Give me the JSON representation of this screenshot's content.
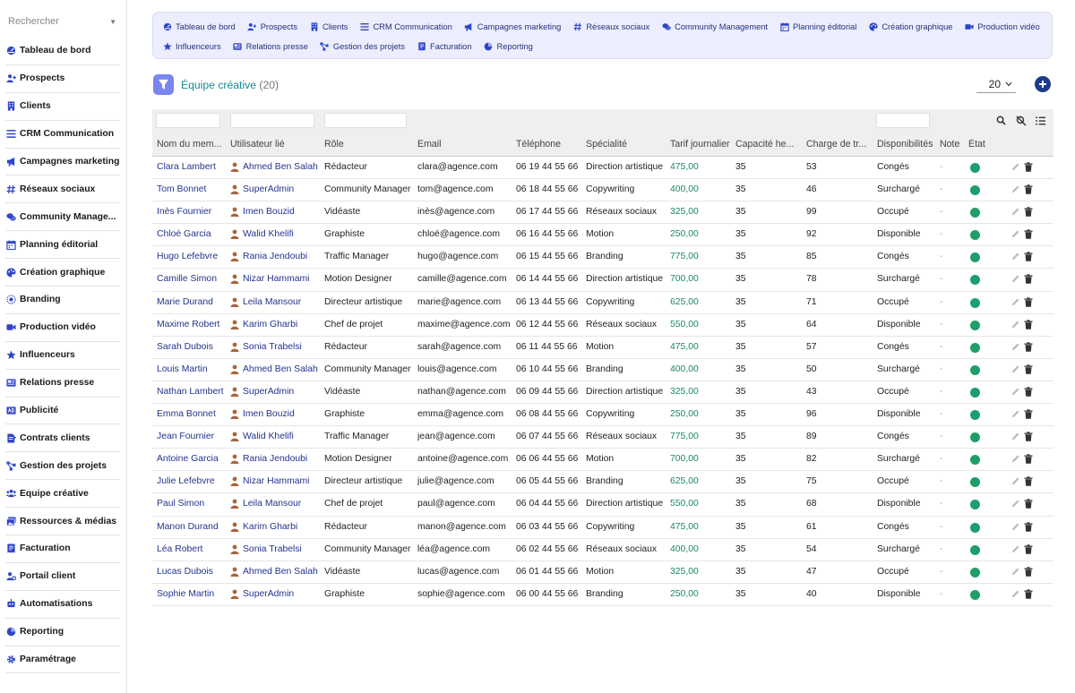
{
  "sidebar": {
    "search_placeholder": "Rechercher",
    "items": [
      {
        "label": "Tableau de bord",
        "icon": "dashboard-icon"
      },
      {
        "label": "Prospects",
        "icon": "user-plus-icon"
      },
      {
        "label": "Clients",
        "icon": "building-icon"
      },
      {
        "label": "CRM Communication",
        "icon": "list-icon"
      },
      {
        "label": "Campagnes marketing",
        "icon": "megaphone-icon"
      },
      {
        "label": "Réseaux sociaux",
        "icon": "hashtag-icon"
      },
      {
        "label": "Community Manage...",
        "icon": "chat-icon"
      },
      {
        "label": "Planning éditorial",
        "icon": "calendar-icon"
      },
      {
        "label": "Création graphique",
        "icon": "palette-icon"
      },
      {
        "label": "Branding",
        "icon": "brand-icon"
      },
      {
        "label": "Production vidéo",
        "icon": "video-icon"
      },
      {
        "label": "Influenceurs",
        "icon": "star-icon"
      },
      {
        "label": "Relations presse",
        "icon": "newspaper-icon"
      },
      {
        "label": "Publicité",
        "icon": "ad-icon"
      },
      {
        "label": "Contrats clients",
        "icon": "contract-icon"
      },
      {
        "label": "Gestion des projets",
        "icon": "project-icon"
      },
      {
        "label": "Équipe créative",
        "icon": "team-icon"
      },
      {
        "label": "Ressources & médias",
        "icon": "media-icon"
      },
      {
        "label": "Facturation",
        "icon": "invoice-icon"
      },
      {
        "label": "Portail client",
        "icon": "portal-icon"
      },
      {
        "label": "Automatisations",
        "icon": "robot-icon"
      },
      {
        "label": "Reporting",
        "icon": "chart-icon"
      },
      {
        "label": "Paramétrage",
        "icon": "gear-icon"
      }
    ]
  },
  "toolbar": {
    "row1": [
      {
        "label": "Tableau de bord",
        "icon": "dashboard-icon"
      },
      {
        "label": "Prospects",
        "icon": "user-plus-icon"
      },
      {
        "label": "Clients",
        "icon": "building-icon"
      },
      {
        "label": "CRM Communication",
        "icon": "list-icon"
      },
      {
        "label": "Campagnes marketing",
        "icon": "megaphone-icon"
      },
      {
        "label": "Réseaux sociaux",
        "icon": "hashtag-icon"
      },
      {
        "label": "Community Management",
        "icon": "chat-icon"
      },
      {
        "label": "Planning éditorial",
        "icon": "calendar-icon"
      },
      {
        "label": "Création graphique",
        "icon": "palette-icon"
      },
      {
        "label": "Production vidéo",
        "icon": "video-icon"
      }
    ],
    "row2": [
      {
        "label": "Influenceurs",
        "icon": "star-icon"
      },
      {
        "label": "Relations presse",
        "icon": "newspaper-icon"
      },
      {
        "label": "Gestion des projets",
        "icon": "project-icon"
      },
      {
        "label": "Facturation",
        "icon": "invoice-icon"
      },
      {
        "label": "Reporting",
        "icon": "chart-icon"
      }
    ]
  },
  "header": {
    "title": "Équipe créative",
    "count": "(20)",
    "page_size": "20"
  },
  "table": {
    "columns": [
      "Nom du mem...",
      "Utilisateur lié",
      "Rôle",
      "Email",
      "Téléphone",
      "Spécialité",
      "Tarif journalier",
      "Capacité he...",
      "Charge de tr...",
      "Disponibilités",
      "Note",
      "État"
    ],
    "rows": [
      [
        "Clara Lambert",
        "Ahmed Ben Salah",
        "Rédacteur",
        "clara@agence.com",
        "06 19 44 55 66",
        "Direction artistique",
        "475,00",
        "35",
        "53",
        "Congés",
        "-"
      ],
      [
        "Tom Bonnet",
        "SuperAdmin",
        "Community Manager",
        "tom@agence.com",
        "06 18 44 55 66",
        "Copywriting",
        "400,00",
        "35",
        "46",
        "Surchargé",
        "-"
      ],
      [
        "Inès Fournier",
        "Imen Bouzid",
        "Vidéaste",
        "inès@agence.com",
        "06 17 44 55 66",
        "Réseaux sociaux",
        "325,00",
        "35",
        "99",
        "Occupé",
        "-"
      ],
      [
        "Chloé Garcia",
        "Walid Khelifi",
        "Graphiste",
        "chloé@agence.com",
        "06 16 44 55 66",
        "Motion",
        "250,00",
        "35",
        "92",
        "Disponible",
        "-"
      ],
      [
        "Hugo Lefebvre",
        "Rania Jendoubi",
        "Traffic Manager",
        "hugo@agence.com",
        "06 15 44 55 66",
        "Branding",
        "775,00",
        "35",
        "85",
        "Congés",
        "-"
      ],
      [
        "Camille Simon",
        "Nizar Hammami",
        "Motion Designer",
        "camille@agence.com",
        "06 14 44 55 66",
        "Direction artistique",
        "700,00",
        "35",
        "78",
        "Surchargé",
        "-"
      ],
      [
        "Marie Durand",
        "Leila Mansour",
        "Directeur artistique",
        "marie@agence.com",
        "06 13 44 55 66",
        "Copywriting",
        "625,00",
        "35",
        "71",
        "Occupé",
        "-"
      ],
      [
        "Maxime Robert",
        "Karim Gharbi",
        "Chef de projet",
        "maxime@agence.com",
        "06 12 44 55 66",
        "Réseaux sociaux",
        "550,00",
        "35",
        "64",
        "Disponible",
        "-"
      ],
      [
        "Sarah Dubois",
        "Sonia Trabelsi",
        "Rédacteur",
        "sarah@agence.com",
        "06 11 44 55 66",
        "Motion",
        "475,00",
        "35",
        "57",
        "Congés",
        "-"
      ],
      [
        "Louis Martin",
        "Ahmed Ben Salah",
        "Community Manager",
        "louis@agence.com",
        "06 10 44 55 66",
        "Branding",
        "400,00",
        "35",
        "50",
        "Surchargé",
        "-"
      ],
      [
        "Nathan Lambert",
        "SuperAdmin",
        "Vidéaste",
        "nathan@agence.com",
        "06 09 44 55 66",
        "Direction artistique",
        "325,00",
        "35",
        "43",
        "Occupé",
        "-"
      ],
      [
        "Emma Bonnet",
        "Imen Bouzid",
        "Graphiste",
        "emma@agence.com",
        "06 08 44 55 66",
        "Copywriting",
        "250,00",
        "35",
        "96",
        "Disponible",
        "-"
      ],
      [
        "Jean Fournier",
        "Walid Khelifi",
        "Traffic Manager",
        "jean@agence.com",
        "06 07 44 55 66",
        "Réseaux sociaux",
        "775,00",
        "35",
        "89",
        "Congés",
        "-"
      ],
      [
        "Antoine Garcia",
        "Rania Jendoubi",
        "Motion Designer",
        "antoine@agence.com",
        "06 06 44 55 66",
        "Motion",
        "700,00",
        "35",
        "82",
        "Surchargé",
        "-"
      ],
      [
        "Julie Lefebvre",
        "Nizar Hammami",
        "Directeur artistique",
        "julie@agence.com",
        "06 05 44 55 66",
        "Branding",
        "625,00",
        "35",
        "75",
        "Occupé",
        "-"
      ],
      [
        "Paul Simon",
        "Leila Mansour",
        "Chef de projet",
        "paul@agence.com",
        "06 04 44 55 66",
        "Direction artistique",
        "550,00",
        "35",
        "68",
        "Disponible",
        "-"
      ],
      [
        "Manon Durand",
        "Karim Gharbi",
        "Rédacteur",
        "manon@agence.com",
        "06 03 44 55 66",
        "Copywriting",
        "475,00",
        "35",
        "61",
        "Congés",
        "-"
      ],
      [
        "Léa Robert",
        "Sonia Trabelsi",
        "Community Manager",
        "léa@agence.com",
        "06 02 44 55 66",
        "Réseaux sociaux",
        "400,00",
        "35",
        "54",
        "Surchargé",
        "-"
      ],
      [
        "Lucas Dubois",
        "Ahmed Ben Salah",
        "Vidéaste",
        "lucas@agence.com",
        "06 01 44 55 66",
        "Motion",
        "325,00",
        "35",
        "47",
        "Occupé",
        "-"
      ],
      [
        "Sophie Martin",
        "SuperAdmin",
        "Graphiste",
        "sophie@agence.com",
        "06 00 44 55 66",
        "Branding",
        "250,00",
        "35",
        "40",
        "Disponible",
        "-"
      ]
    ]
  },
  "colors": {
    "accent": "#23338c",
    "title": "#178a96",
    "rate": "#178a60",
    "status_dot": "#1e9e6a",
    "toolbar_bg": "#eceefe",
    "filter_button": "#7b85f0",
    "add_button": "#1e3a8a"
  }
}
